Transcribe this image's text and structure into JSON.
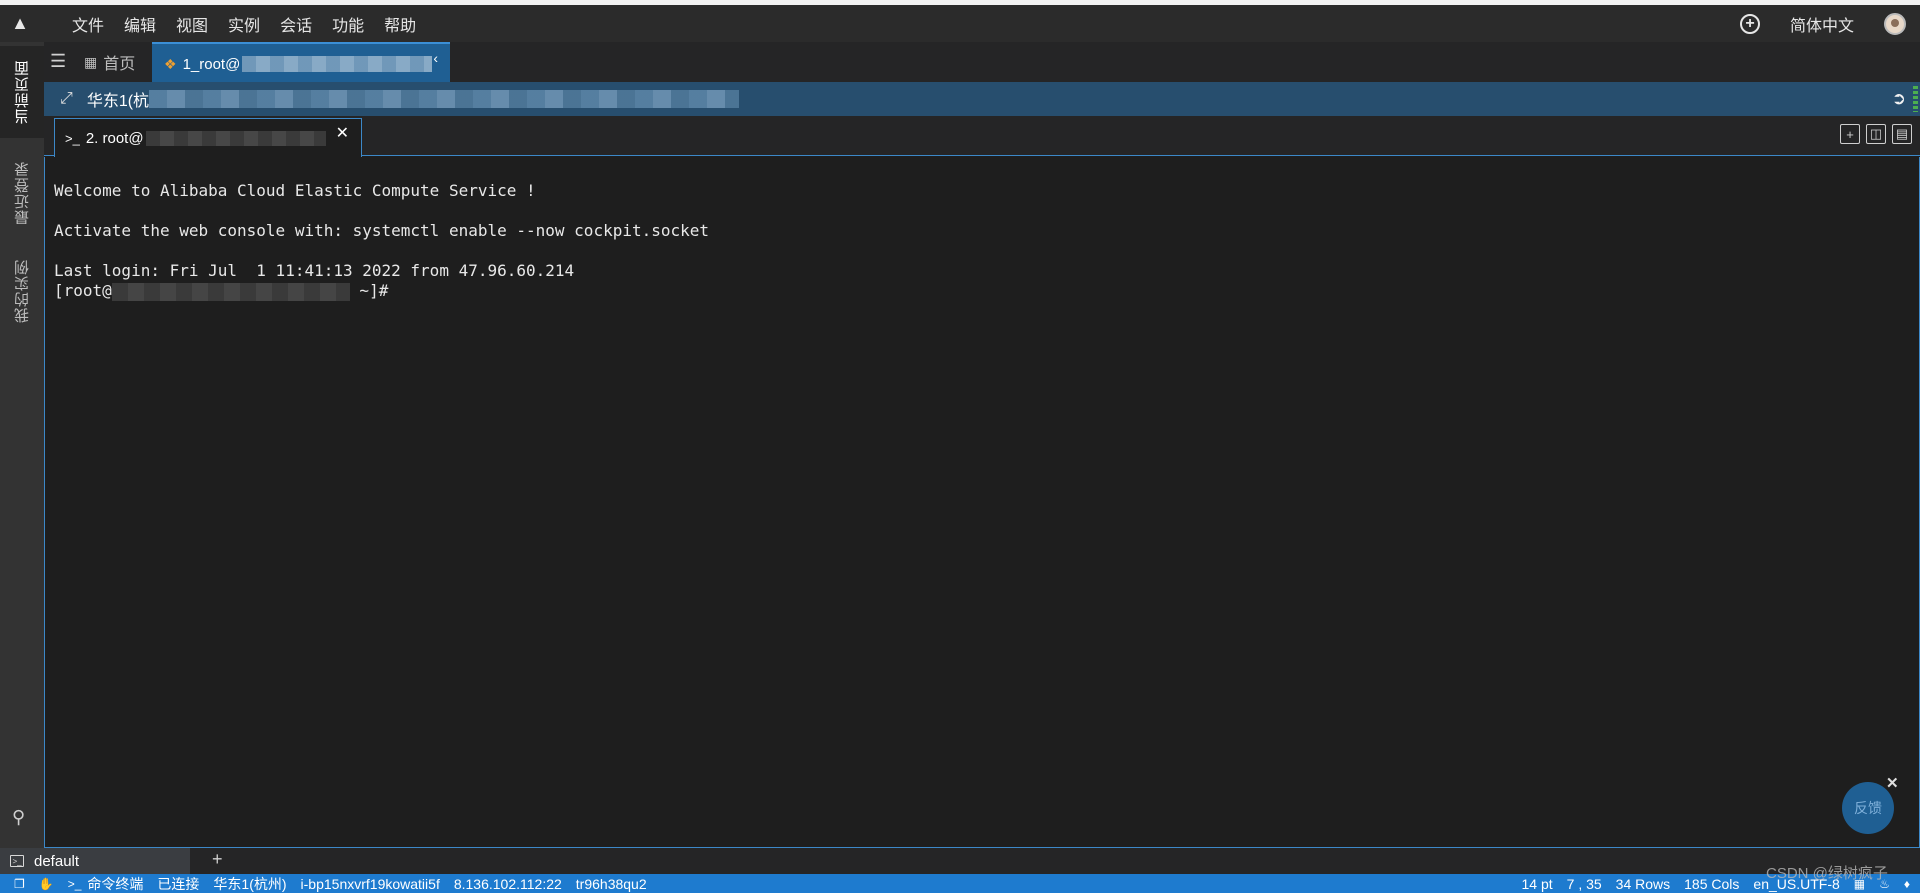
{
  "menubar": {
    "logo_icon": "linux-penguin-icon",
    "items": [
      "文件",
      "编辑",
      "视图",
      "实例",
      "会话",
      "功能",
      "帮助"
    ],
    "language": "简体中文"
  },
  "sidebar": {
    "tabs": [
      "当前页面",
      "最近登录",
      "我的实例"
    ]
  },
  "tabs": {
    "home_label": "首页",
    "session_label": "1_root@"
  },
  "hostbar": {
    "region_label": "华东1(杭"
  },
  "terminal_tab": {
    "label": "2. root@"
  },
  "terminal": {
    "lines": [
      "Welcome to Alibaba Cloud Elastic Compute Service !",
      "Activate the web console with: systemctl enable --now cockpit.socket",
      "Last login: Fri Jul  1 11:41:13 2022 from 47.96.60.214"
    ],
    "prompt_start": "[root@",
    "prompt_end": " ~]#"
  },
  "feedback": {
    "label": "反馈"
  },
  "session_bar": {
    "default_label": "default",
    "add_label": "+"
  },
  "statusbar": {
    "terminal_label": "命令终端",
    "connection": "已连接",
    "region": "华东1(杭州)",
    "instance_id": "i-bp15nxvrf19kowatii5f",
    "ip": "8.136.102.112:22",
    "code": "tr96h38qu2",
    "font_size": "14 pt",
    "cursor_pos": "7 , 35",
    "rows": "34 Rows",
    "cols": "185 Cols",
    "encoding": "en_US.UTF-8"
  },
  "watermark": "CSDN @绿树疯子"
}
